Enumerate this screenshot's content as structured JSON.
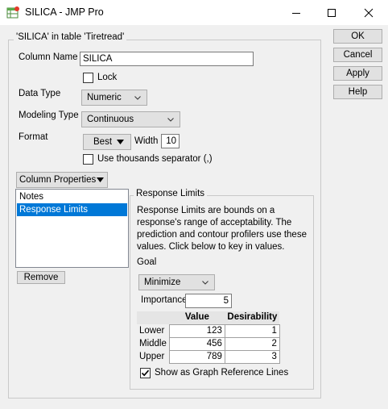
{
  "window": {
    "title": "SILICA - JMP Pro",
    "app_icon": "jmp-table-icon",
    "controls": [
      "minimize-icon",
      "maximize-icon",
      "close-icon"
    ]
  },
  "group": {
    "legend": "'SILICA' in table 'Tiretread'"
  },
  "column_name": {
    "label": "Column Name",
    "value": "SILICA"
  },
  "lock": {
    "label": "Lock",
    "checked": false
  },
  "data_type": {
    "label": "Data Type",
    "value": "Numeric"
  },
  "modeling_type": {
    "label": "Modeling Type",
    "value": "Continuous"
  },
  "format": {
    "label": "Format",
    "value": "Best",
    "width_label": "Width",
    "width_value": "10",
    "thousands_label": "Use thousands separator (,)",
    "thousands_checked": false
  },
  "column_properties": {
    "button_label": "Column Properties",
    "items": [
      {
        "label": "Notes",
        "selected": false
      },
      {
        "label": "Response Limits",
        "selected": true
      }
    ],
    "remove_label": "Remove"
  },
  "response_limits": {
    "legend": "Response Limits",
    "description": "Response Limits are bounds on a response's range of acceptability. The prediction and contour profilers use these values. Click below to key in values.",
    "goal_label": "Goal",
    "goal_value": "Minimize",
    "importance_label": "Importance",
    "importance_value": "5",
    "table": {
      "headers": [
        "",
        "Value",
        "Desirability"
      ],
      "rows": [
        {
          "label": "Lower",
          "value": "123",
          "desirability": "1"
        },
        {
          "label": "Middle",
          "value": "456",
          "desirability": "2"
        },
        {
          "label": "Upper",
          "value": "789",
          "desirability": "3"
        }
      ]
    },
    "ref_lines_label": "Show as Graph Reference Lines",
    "ref_lines_checked": true
  },
  "buttons": {
    "ok": "OK",
    "cancel": "Cancel",
    "apply": "Apply",
    "help": "Help"
  },
  "colors": {
    "selection": "#0078d7",
    "window_bg": "#f0f0f0",
    "button_bg": "#e1e1e1"
  }
}
